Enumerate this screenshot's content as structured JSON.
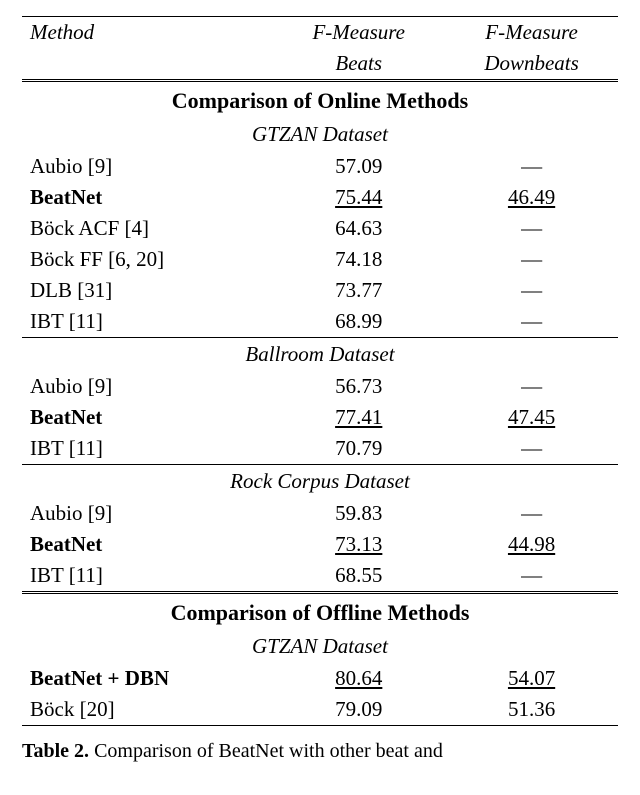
{
  "header": {
    "method": "Method",
    "beats1": "F-Measure",
    "beats2": "Beats",
    "down1": "F-Measure",
    "down2": "Downbeats"
  },
  "sections": {
    "online": "Comparison of Online Methods",
    "offline": "Comparison of Offline Methods"
  },
  "datasets": {
    "gtzan": "GTZAN Dataset",
    "ballroom": "Ballroom Dataset",
    "rock": "Rock Corpus Dataset"
  },
  "dash": "—",
  "chart_data": {
    "type": "table",
    "title": "Comparison of BeatNet with other beat/downbeat tracking methods",
    "columns": [
      "Method",
      "F-Measure Beats",
      "F-Measure Downbeats"
    ],
    "groups": [
      {
        "section": "Comparison of Online Methods",
        "dataset": "GTZAN Dataset",
        "rows": [
          {
            "method": "Aubio [9]",
            "beats": 57.09,
            "downbeats": null,
            "bold": false
          },
          {
            "method": "BeatNet",
            "beats": 75.44,
            "downbeats": 46.49,
            "bold": true,
            "underline": true
          },
          {
            "method": "Böck ACF [4]",
            "beats": 64.63,
            "downbeats": null,
            "bold": false
          },
          {
            "method": "Böck FF [6, 20]",
            "beats": 74.18,
            "downbeats": null,
            "bold": false
          },
          {
            "method": "DLB [31]",
            "beats": 73.77,
            "downbeats": null,
            "bold": false
          },
          {
            "method": "IBT [11]",
            "beats": 68.99,
            "downbeats": null,
            "bold": false
          }
        ]
      },
      {
        "section": "Comparison of Online Methods",
        "dataset": "Ballroom Dataset",
        "rows": [
          {
            "method": "Aubio [9]",
            "beats": 56.73,
            "downbeats": null,
            "bold": false
          },
          {
            "method": "BeatNet",
            "beats": 77.41,
            "downbeats": 47.45,
            "bold": true,
            "underline": true
          },
          {
            "method": "IBT [11]",
            "beats": 70.79,
            "downbeats": null,
            "bold": false
          }
        ]
      },
      {
        "section": "Comparison of Online Methods",
        "dataset": "Rock Corpus Dataset",
        "rows": [
          {
            "method": "Aubio [9]",
            "beats": 59.83,
            "downbeats": null,
            "bold": false
          },
          {
            "method": "BeatNet",
            "beats": 73.13,
            "downbeats": 44.98,
            "bold": true,
            "underline": true
          },
          {
            "method": "IBT [11]",
            "beats": 68.55,
            "downbeats": null,
            "bold": false
          }
        ]
      },
      {
        "section": "Comparison of Offline Methods",
        "dataset": "GTZAN Dataset",
        "rows": [
          {
            "method": "BeatNet + DBN",
            "beats": 80.64,
            "downbeats": 54.07,
            "bold": true,
            "underline": true
          },
          {
            "method": "Böck [20]",
            "beats": 79.09,
            "downbeats": 51.36,
            "bold": false
          }
        ]
      }
    ]
  },
  "rows": {
    "g0": {
      "m": "Aubio [9]",
      "b": "57.09"
    },
    "g1": {
      "m": "BeatNet",
      "b": "75.44",
      "d": "46.49"
    },
    "g2": {
      "m": "Böck ACF [4]",
      "b": "64.63"
    },
    "g3": {
      "m": "Böck FF [6, 20]",
      "b": "74.18"
    },
    "g4": {
      "m": "DLB [31]",
      "b": "73.77"
    },
    "g5": {
      "m": "IBT [11]",
      "b": "68.99"
    },
    "b0": {
      "m": "Aubio [9]",
      "b": "56.73"
    },
    "b1": {
      "m": "BeatNet",
      "b": "77.41",
      "d": "47.45"
    },
    "b2": {
      "m": "IBT [11]",
      "b": "70.79"
    },
    "r0": {
      "m": "Aubio [9]",
      "b": "59.83"
    },
    "r1": {
      "m": "BeatNet",
      "b": "73.13",
      "d": "44.98"
    },
    "r2": {
      "m": "IBT [11]",
      "b": "68.55"
    },
    "o0": {
      "m": "BeatNet + DBN",
      "b": "80.64",
      "d": "54.07"
    },
    "o1": {
      "m": "Böck [20]",
      "b": "79.09",
      "d": "51.36"
    }
  },
  "caption": {
    "label": "Table 2.",
    "text": "Comparison of BeatNet with other beat and"
  }
}
